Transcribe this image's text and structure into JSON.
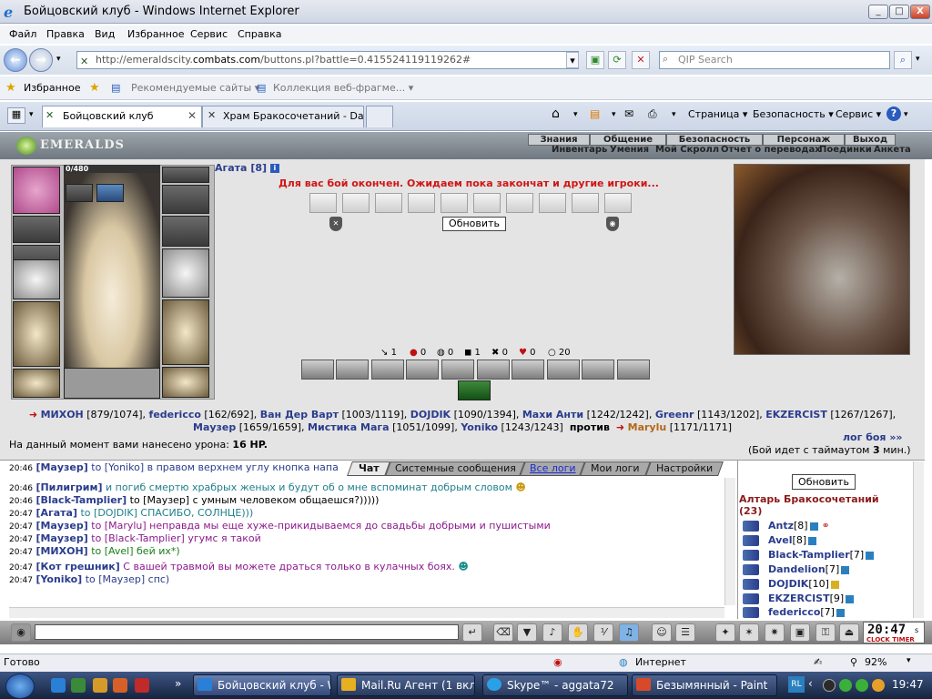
{
  "window": {
    "title": "Бойцовский клуб - Windows Internet Explorer",
    "btn_min": "_",
    "btn_max": "□",
    "btn_close": "X"
  },
  "menu": [
    "Файл",
    "Правка",
    "Вид",
    "Избранное",
    "Сервис",
    "Справка"
  ],
  "address": {
    "url_prefix": "http://emeraldscity.",
    "url_domain": "combats.com",
    "url_suffix": "/buttons.pl?battle=0.415524119119262#",
    "search_placeholder": "QIP Search"
  },
  "favorites": {
    "label": "Избранное",
    "items": [
      "Рекомендуемые сайты ▾",
      "Коллекция веб-фрагме... ▾"
    ]
  },
  "tabs": [
    "Бойцовский клуб",
    "Храм Бракосочетаний - Dar..."
  ],
  "commandbar": [
    "Страница ▾",
    "Безопасность ▾",
    "Сервис ▾"
  ],
  "game": {
    "logo": "EMERALDS",
    "topnav": [
      "Знания",
      "Общение",
      "Безопасность",
      "Персонаж",
      "Выход"
    ],
    "subnav": [
      "Инвентарь",
      "Умения",
      "Мой Скролл",
      "Отчет о переводах",
      "Поединки",
      "Анкета"
    ],
    "hp_text": "0/480",
    "player_name": "Агата",
    "player_level": "[8]",
    "info_i": "i",
    "fight_message": "Для вас бой окончен. Ожидаем пока закончат и другие игроки...",
    "refresh_label": "Обновить",
    "stats": [
      {
        "icon": "↘",
        "value": "1"
      },
      {
        "icon": "●",
        "value": "0"
      },
      {
        "icon": "◍",
        "value": "0"
      },
      {
        "icon": "◼",
        "value": "1"
      },
      {
        "icon": "✖",
        "value": "0"
      },
      {
        "icon": "♥",
        "value": "0"
      },
      {
        "icon": "○",
        "value": "20"
      }
    ],
    "team_a": [
      {
        "name": "МИХОН",
        "hp": "[879/1074],"
      },
      {
        "name": "federicco",
        "hp": "[162/692],"
      },
      {
        "name": "Ван Дер Варт",
        "hp": "[1003/1119],"
      },
      {
        "name": "DOJDIK",
        "hp": "[1090/1394],"
      },
      {
        "name": "Махи Анти",
        "hp": "[1242/1242],"
      },
      {
        "name": "Greenr",
        "hp": "[1143/1202],"
      },
      {
        "name": "EKZERCIST",
        "hp": "[1267/1267],"
      },
      {
        "name": "Маузер",
        "hp": "[1659/1659],"
      },
      {
        "name": "Мистика Мага",
        "hp": "[1051/1099],"
      },
      {
        "name": "Yoniko",
        "hp": "[1243/1243]"
      }
    ],
    "versus": "против",
    "team_b": {
      "name": "Marylu",
      "hp": "[1171/1171]"
    },
    "damage_prefix": "На данный момент вами нанесено урона:",
    "damage_value": "16 HP.",
    "log_link": "лог боя »»",
    "timeout_text": "(Бой идет с таймаутом",
    "timeout_value": "3",
    "timeout_suffix": "мин.)"
  },
  "chat": {
    "tabs": [
      "Чат",
      "Системные сообщения",
      "Все логи",
      "Мои логи",
      "Настройки"
    ],
    "lines": [
      {
        "time": "20:46",
        "name": "[Маузер]",
        "text": "to [Yoniko] в правом верхнем углу кнопка напа",
        "cls": "m1"
      },
      {
        "time": "20:46",
        "name": "[Пилигрим]",
        "text": "и погиб смертю храбрых женых и будут об о мне вспоминат добрым словом",
        "cls": "m2"
      },
      {
        "time": "20:46",
        "name": "[Black-Tamplier]",
        "text": "to [Маузер] с умным человеком общаешся?)))))",
        "cls": "m0"
      },
      {
        "time": "20:47",
        "name": "[Агата]",
        "text": "to [DOJDIK] СПАСИБО, СОЛНЦЕ)))",
        "cls": "m2"
      },
      {
        "time": "20:47",
        "name": "[Маузер]",
        "text": "to [Marylu] неправда мы еще хуже-прикидываемся до свадьбы добрыми и пушистыми",
        "cls": "m3"
      },
      {
        "time": "20:47",
        "name": "[Маузер]",
        "text": "to [Black-Tamplier] угумс я такой",
        "cls": "m3"
      },
      {
        "time": "20:47",
        "name": "[МИХОН]",
        "text": "to [Avel] бей их*)",
        "cls": "m4"
      },
      {
        "time": "20:47",
        "name": "[Кот грешник]",
        "text": "С вашей травмой вы можете драться только в кулачных боях.",
        "cls": "m3"
      },
      {
        "time": "20:47",
        "name": "[Yoniko]",
        "text": "to [Маузер] спс)",
        "cls": "m1"
      }
    ]
  },
  "location": {
    "refresh_label": "Обновить",
    "title": "Алтарь Бракосочетаний",
    "count": "(23)",
    "users": [
      {
        "name": "Antz",
        "level": "[8]"
      },
      {
        "name": "Avel",
        "level": "[8]"
      },
      {
        "name": "Black-Tamplier",
        "level": "[7]"
      },
      {
        "name": "Dandelion",
        "level": "[7]"
      },
      {
        "name": "DOJDIK",
        "level": "[10]"
      },
      {
        "name": "EKZERCIST",
        "level": "[9]"
      },
      {
        "name": "federicco",
        "level": "[7]"
      }
    ]
  },
  "bottombar": {
    "clock_time": "20:47",
    "clock_sec": "s",
    "clock_label": "CLOCK TIMER"
  },
  "status": {
    "left": "Готово",
    "zone": "Интернет",
    "zoom": "92%"
  },
  "taskbar": {
    "tasks": [
      "Бойцовский клуб - Wi...",
      "Mail.Ru Агент (1 вкла...",
      "Skype™ - aggata72",
      "Безымянный - Paint"
    ],
    "lang": "RL",
    "time": "19:47"
  }
}
